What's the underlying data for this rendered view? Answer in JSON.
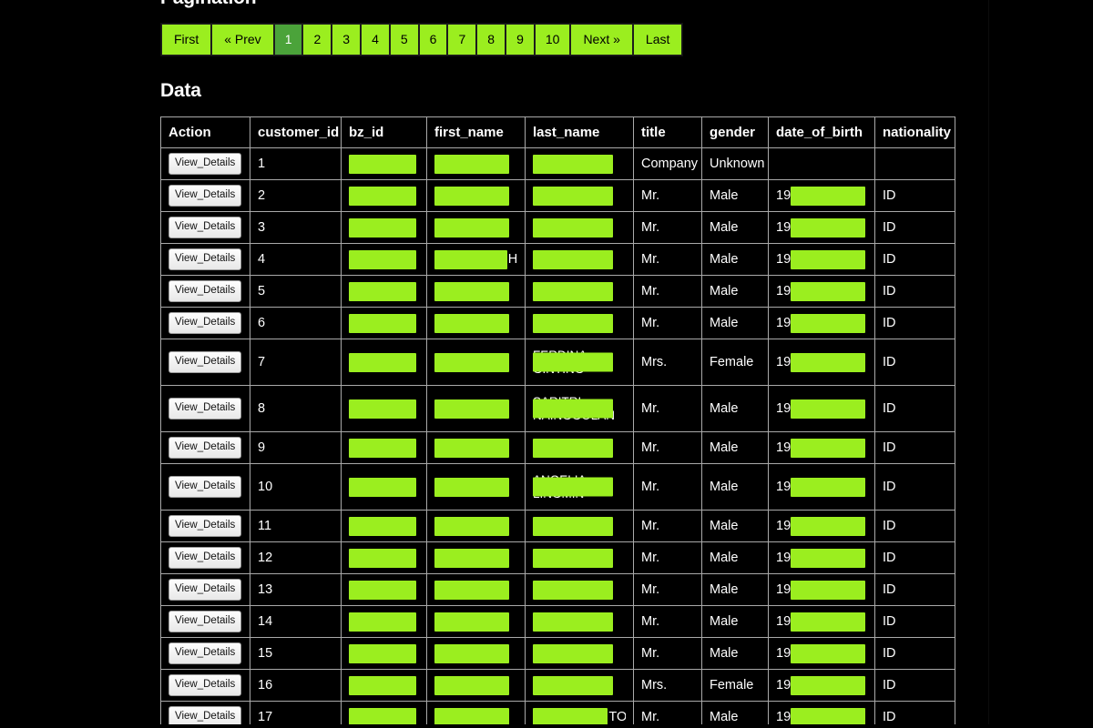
{
  "sections": {
    "pagination_title": "Pagination",
    "data_title": "Data"
  },
  "colors": {
    "highlight": "#9bee1f",
    "active_page": "#4ba33a",
    "background": "#000000",
    "table_border": "#a9a9a9",
    "text": "#ffffff"
  },
  "pagination": {
    "first_label": "First",
    "prev_label": "« Prev",
    "next_label": "Next »",
    "last_label": "Last",
    "pages": [
      "1",
      "2",
      "3",
      "4",
      "5",
      "6",
      "7",
      "8",
      "9",
      "10"
    ],
    "active_page": "1"
  },
  "table": {
    "action_label": "View_Details",
    "headers": [
      "Action",
      "customer_id",
      "bz_id",
      "first_name",
      "last_name",
      "title",
      "gender",
      "date_of_birth",
      "nationality"
    ],
    "rows": [
      {
        "customer_id": "1",
        "bz_id": "",
        "first_name": "",
        "last_name": "",
        "title": "Company",
        "gender": "Unknown",
        "date_of_birth": "",
        "nationality": ""
      },
      {
        "customer_id": "2",
        "bz_id": "",
        "first_name": "",
        "last_name": "",
        "title": "Mr.",
        "gender": "Male",
        "date_of_birth": "19",
        "nationality": "ID"
      },
      {
        "customer_id": "3",
        "bz_id": "",
        "first_name": "",
        "last_name": "",
        "title": "Mr.",
        "gender": "Male",
        "date_of_birth": "19",
        "nationality": "ID"
      },
      {
        "customer_id": "4",
        "bz_id": "",
        "first_name": "",
        "first_name_suffix": "H",
        "last_name": "",
        "title": "Mr.",
        "gender": "Male",
        "date_of_birth": "19",
        "nationality": "ID"
      },
      {
        "customer_id": "5",
        "bz_id": "",
        "first_name": "",
        "last_name": "",
        "title": "Mr.",
        "gender": "Male",
        "date_of_birth": "19",
        "nationality": "ID"
      },
      {
        "customer_id": "6",
        "bz_id": "",
        "first_name": "",
        "last_name": "",
        "title": "Mr.",
        "gender": "Male",
        "date_of_birth": "19",
        "nationality": "ID"
      },
      {
        "customer_id": "7",
        "bz_id": "",
        "first_name": "",
        "last_name_line1": "FERDINA",
        "last_name_line2": "GINTING",
        "title": "Mrs.",
        "gender": "Female",
        "date_of_birth": "19",
        "nationality": "ID",
        "tall": true
      },
      {
        "customer_id": "8",
        "bz_id": "",
        "first_name": "",
        "last_name_line1": "SARITRI",
        "last_name_line2": "NAINGGOLAN",
        "title": "Mr.",
        "gender": "Male",
        "date_of_birth": "19",
        "nationality": "ID",
        "tall": true
      },
      {
        "customer_id": "9",
        "bz_id": "",
        "first_name": "",
        "last_name": "",
        "title": "Mr.",
        "gender": "Male",
        "date_of_birth": "19",
        "nationality": "ID"
      },
      {
        "customer_id": "10",
        "bz_id": "",
        "first_name": "",
        "last_name_line1": "ANGELIA",
        "last_name_line2": "LINGMIN",
        "title": "Mr.",
        "gender": "Male",
        "date_of_birth": "19",
        "nationality": "ID",
        "tall": true
      },
      {
        "customer_id": "11",
        "bz_id": "",
        "first_name": "",
        "last_name": "",
        "title": "Mr.",
        "gender": "Male",
        "date_of_birth": "19",
        "nationality": "ID"
      },
      {
        "customer_id": "12",
        "bz_id": "",
        "first_name": "",
        "last_name": "",
        "title": "Mr.",
        "gender": "Male",
        "date_of_birth": "19",
        "nationality": "ID"
      },
      {
        "customer_id": "13",
        "bz_id": "",
        "first_name": "",
        "last_name": "",
        "title": "Mr.",
        "gender": "Male",
        "date_of_birth": "19",
        "nationality": "ID"
      },
      {
        "customer_id": "14",
        "bz_id": "",
        "first_name": "",
        "last_name": "",
        "title": "Mr.",
        "gender": "Male",
        "date_of_birth": "19",
        "nationality": "ID"
      },
      {
        "customer_id": "15",
        "bz_id": "",
        "first_name": "",
        "last_name": "",
        "title": "Mr.",
        "gender": "Male",
        "date_of_birth": "19",
        "nationality": "ID"
      },
      {
        "customer_id": "16",
        "bz_id": "",
        "first_name": "",
        "last_name": "",
        "title": "Mrs.",
        "gender": "Female",
        "date_of_birth": "19",
        "nationality": "ID"
      },
      {
        "customer_id": "17",
        "bz_id": "",
        "first_name": "",
        "last_name": "",
        "last_name_suffix": "TO",
        "title": "Mr.",
        "gender": "Male",
        "date_of_birth": "19",
        "nationality": "ID"
      }
    ]
  }
}
